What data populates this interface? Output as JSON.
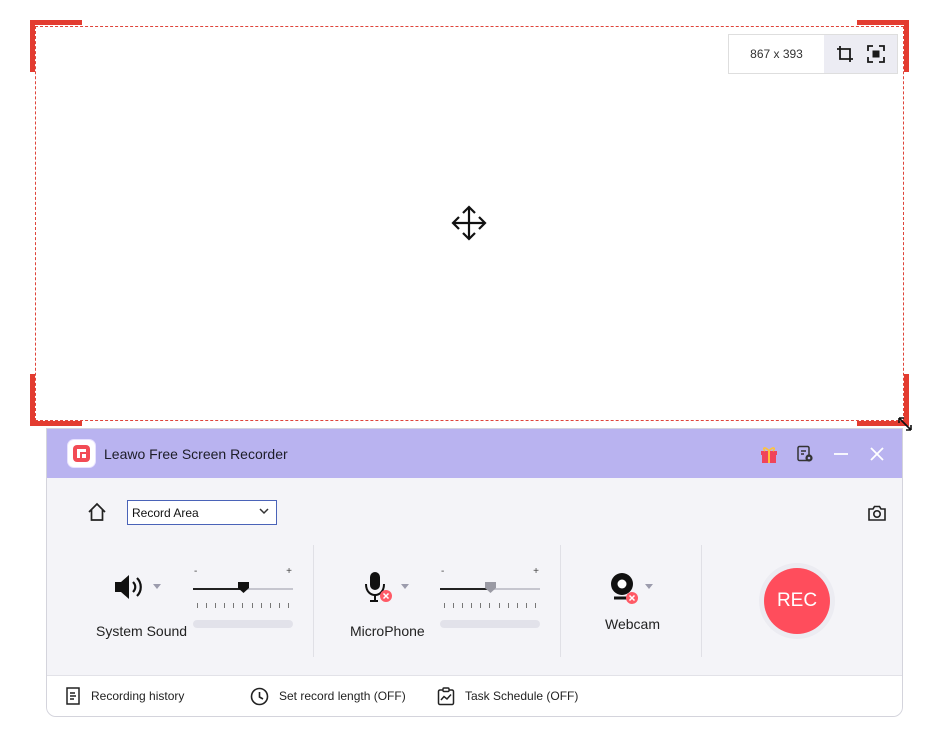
{
  "region": {
    "size_label": "867 x 393",
    "icons": {
      "crop": "crop-icon",
      "fullscreen": "fullscreen-icon",
      "move": "move-cursor-icon",
      "resize": "resize-handle-icon"
    }
  },
  "window": {
    "title": "Leawo Free Screen Recorder",
    "icons": {
      "logo": "app-logo-icon",
      "gift": "gift-icon",
      "settings": "settings-icon",
      "minimize": "minimize-icon",
      "close": "close-icon"
    }
  },
  "controls": {
    "mode": {
      "selected": "Record Area"
    },
    "system_sound": {
      "label": "System Sound",
      "volume_min": "-",
      "volume_max": "+",
      "volume_level": 0.5
    },
    "microphone": {
      "label": "MicroPhone",
      "volume_min": "-",
      "volume_max": "+",
      "volume_level": 0.5
    },
    "webcam": {
      "label": "Webcam"
    },
    "rec_label": "REC"
  },
  "footer": {
    "history": "Recording history",
    "record_length": "Set record length (OFF)",
    "schedule": "Task Schedule (OFF)"
  },
  "colors": {
    "accent": "#b9b3f0",
    "rec": "#ff4d5c",
    "frame": "#e33c30",
    "disabled_badge": "#ff5a66"
  }
}
